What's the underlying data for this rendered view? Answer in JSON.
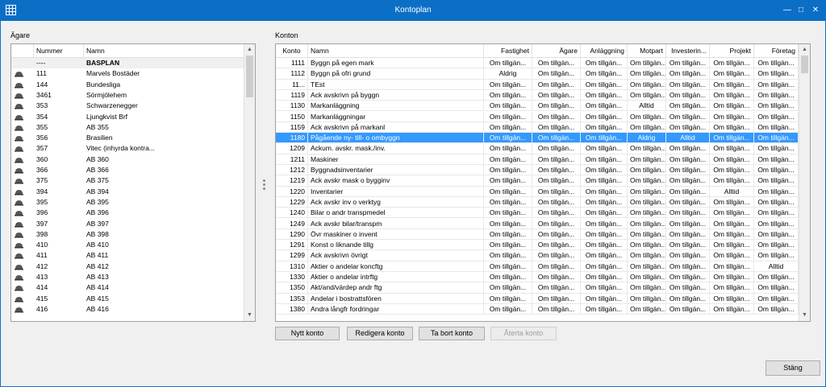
{
  "window": {
    "title": "Kontoplan",
    "minimize": "—",
    "maximize": "□",
    "close": "✕"
  },
  "owners": {
    "label": "Ägare",
    "columns": [
      "",
      "Nummer",
      "Namn"
    ],
    "rows": [
      {
        "icon": false,
        "number": "----",
        "name": "BASPLAN"
      },
      {
        "icon": true,
        "number": "111",
        "name": "Marvels Bostäder"
      },
      {
        "icon": true,
        "number": "144",
        "name": "Bundesliga"
      },
      {
        "icon": true,
        "number": "3461",
        "name": "Sörmjölehem"
      },
      {
        "icon": true,
        "number": "353",
        "name": "Schwarzenegger"
      },
      {
        "icon": true,
        "number": "354",
        "name": "Ljungkvist Brf"
      },
      {
        "icon": true,
        "number": "355",
        "name": "AB 355"
      },
      {
        "icon": true,
        "number": "356",
        "name": "Brasilien"
      },
      {
        "icon": true,
        "number": "357",
        "name": "Vitec (inhyrda kontra..."
      },
      {
        "icon": true,
        "number": "360",
        "name": "AB 360"
      },
      {
        "icon": true,
        "number": "366",
        "name": "AB 366"
      },
      {
        "icon": true,
        "number": "375",
        "name": "AB 375"
      },
      {
        "icon": true,
        "number": "394",
        "name": "AB 394"
      },
      {
        "icon": true,
        "number": "395",
        "name": "AB 395"
      },
      {
        "icon": true,
        "number": "396",
        "name": "AB 396"
      },
      {
        "icon": true,
        "number": "397",
        "name": "AB 397"
      },
      {
        "icon": true,
        "number": "398",
        "name": "AB 398"
      },
      {
        "icon": true,
        "number": "410",
        "name": "AB 410"
      },
      {
        "icon": true,
        "number": "411",
        "name": "AB 411"
      },
      {
        "icon": true,
        "number": "412",
        "name": "AB 412"
      },
      {
        "icon": true,
        "number": "413",
        "name": "AB 413"
      },
      {
        "icon": true,
        "number": "414",
        "name": "AB 414"
      },
      {
        "icon": true,
        "number": "415",
        "name": "AB 415"
      },
      {
        "icon": true,
        "number": "416",
        "name": "AB 416"
      }
    ]
  },
  "accounts": {
    "label": "Konton",
    "columns": [
      "Konto",
      "Namn",
      "Fastighet",
      "Ägare",
      "Anläggning",
      "Motpart",
      "Investerin...",
      "Projekt",
      "Företag"
    ],
    "selected_index": 8,
    "rows": [
      {
        "konto": "1111",
        "namn": "Byggn på egen mark",
        "vals": [
          "Om tillgän...",
          "Om tillgän...",
          "Om tillgän...",
          "Om tillgän...",
          "Om tillgän...",
          "Om tillgän...",
          "Om tillgän..."
        ]
      },
      {
        "konto": "1112",
        "namn": "Byggn på ofri grund",
        "vals": [
          "Aldrig",
          "Om tillgän...",
          "Om tillgän...",
          "Om tillgän...",
          "Om tillgän...",
          "Om tillgän...",
          "Om tillgän..."
        ]
      },
      {
        "konto": "11...",
        "namn": "TEst",
        "vals": [
          "Om tillgän...",
          "Om tillgän...",
          "Om tillgän...",
          "Om tillgän...",
          "Om tillgän...",
          "Om tillgän...",
          "Om tillgän..."
        ]
      },
      {
        "konto": "1119",
        "namn": "Ack avskrivn på byggn",
        "vals": [
          "Om tillgän...",
          "Om tillgän...",
          "Om tillgän...",
          "Om tillgän...",
          "Om tillgän...",
          "Om tillgän...",
          "Om tillgän..."
        ]
      },
      {
        "konto": "1130",
        "namn": "Markanläggning",
        "vals": [
          "Om tillgän...",
          "Om tillgän...",
          "Om tillgän...",
          "Alltid",
          "Om tillgän...",
          "Om tillgän...",
          "Om tillgän..."
        ]
      },
      {
        "konto": "1150",
        "namn": "Markanläggningar",
        "vals": [
          "Om tillgän...",
          "Om tillgän...",
          "Om tillgän...",
          "Om tillgän...",
          "Om tillgän...",
          "Om tillgän...",
          "Om tillgän..."
        ]
      },
      {
        "konto": "1159",
        "namn": "Ack avskrivn på markanl",
        "vals": [
          "Om tillgän...",
          "Om tillgän...",
          "Om tillgän...",
          "Om tillgän...",
          "Om tillgän...",
          "Om tillgän...",
          "Om tillgän..."
        ]
      },
      {
        "konto": "1180",
        "namn": "Pågående ny- till- o ombyggn",
        "vals": [
          "Om tillgän...",
          "Om tillgän...",
          "Om tillgän...",
          "Aldrig",
          "Alltid",
          "Om tillgän...",
          "Om tillgän..."
        ]
      },
      {
        "konto": "1209",
        "namn": "Ackum. avskr. mask./inv.",
        "vals": [
          "Om tillgän...",
          "Om tillgän...",
          "Om tillgän...",
          "Om tillgän...",
          "Om tillgän...",
          "Om tillgän...",
          "Om tillgän..."
        ]
      },
      {
        "konto": "1211",
        "namn": "Maskiner",
        "vals": [
          "Om tillgän...",
          "Om tillgän...",
          "Om tillgän...",
          "Om tillgän...",
          "Om tillgän...",
          "Om tillgän...",
          "Om tillgän..."
        ]
      },
      {
        "konto": "1212",
        "namn": "Byggnadsinventarier",
        "vals": [
          "Om tillgän...",
          "Om tillgän...",
          "Om tillgän...",
          "Om tillgän...",
          "Om tillgän...",
          "Om tillgän...",
          "Om tillgän..."
        ]
      },
      {
        "konto": "1219",
        "namn": "Ack avskr mask o bygginv",
        "vals": [
          "Om tillgän...",
          "Om tillgän...",
          "Om tillgän...",
          "Om tillgän...",
          "Om tillgän...",
          "Om tillgän...",
          "Om tillgän..."
        ]
      },
      {
        "konto": "1220",
        "namn": "Inventarier",
        "vals": [
          "Om tillgän...",
          "Om tillgän...",
          "Om tillgän...",
          "Om tillgän...",
          "Om tillgän...",
          "Alltid",
          "Om tillgän..."
        ]
      },
      {
        "konto": "1229",
        "namn": "Ack avskr inv o verktyg",
        "vals": [
          "Om tillgän...",
          "Om tillgän...",
          "Om tillgän...",
          "Om tillgän...",
          "Om tillgän...",
          "Om tillgän...",
          "Om tillgän..."
        ]
      },
      {
        "konto": "1240",
        "namn": "Bilar o andr transpmedel",
        "vals": [
          "Om tillgän...",
          "Om tillgän...",
          "Om tillgän...",
          "Om tillgän...",
          "Om tillgän...",
          "Om tillgän...",
          "Om tillgän..."
        ]
      },
      {
        "konto": "1249",
        "namn": "Ack avskr bilar/transpm",
        "vals": [
          "Om tillgän...",
          "Om tillgän...",
          "Om tillgän...",
          "Om tillgän...",
          "Om tillgän...",
          "Om tillgän...",
          "Om tillgän..."
        ]
      },
      {
        "konto": "1290",
        "namn": "Övr maskiner o invent",
        "vals": [
          "Om tillgän...",
          "Om tillgän...",
          "Om tillgän...",
          "Om tillgän...",
          "Om tillgän...",
          "Om tillgän...",
          "Om tillgän..."
        ]
      },
      {
        "konto": "1291",
        "namn": "Konst o liknande tillg",
        "vals": [
          "Om tillgän...",
          "Om tillgän...",
          "Om tillgän...",
          "Om tillgän...",
          "Om tillgän...",
          "Om tillgän...",
          "Om tillgän..."
        ]
      },
      {
        "konto": "1299",
        "namn": "Ack avskrivn övrigt",
        "vals": [
          "Om tillgän...",
          "Om tillgän...",
          "Om tillgän...",
          "Om tillgän...",
          "Om tillgän...",
          "Om tillgän...",
          "Om tillgän..."
        ]
      },
      {
        "konto": "1310",
        "namn": "Aktier o andelar koncftg",
        "vals": [
          "Om tillgän...",
          "Om tillgän...",
          "Om tillgän...",
          "Om tillgän...",
          "Om tillgän...",
          "Om tillgän...",
          "Alltid"
        ]
      },
      {
        "konto": "1330",
        "namn": "Aktier o andelar intrftg",
        "vals": [
          "Om tillgän...",
          "Om tillgän...",
          "Om tillgän...",
          "Om tillgän...",
          "Om tillgän...",
          "Om tillgän...",
          "Om tillgän..."
        ]
      },
      {
        "konto": "1350",
        "namn": "Akt/and/värdep andr ftg",
        "vals": [
          "Om tillgän...",
          "Om tillgän...",
          "Om tillgän...",
          "Om tillgän...",
          "Om tillgän...",
          "Om tillgän...",
          "Om tillgän..."
        ]
      },
      {
        "konto": "1353",
        "namn": "Andelar i bostrattsfören",
        "vals": [
          "Om tillgän...",
          "Om tillgän...",
          "Om tillgän...",
          "Om tillgän...",
          "Om tillgän...",
          "Om tillgän...",
          "Om tillgän..."
        ]
      },
      {
        "konto": "1380",
        "namn": "Andra långfr fordringar",
        "vals": [
          "Om tillgän...",
          "Om tillgän...",
          "Om tillgän...",
          "Om tillgän...",
          "Om tillgän...",
          "Om tillgän...",
          "Om tillgän..."
        ]
      }
    ]
  },
  "buttons": {
    "new": "Nytt konto",
    "edit": "Redigera konto",
    "delete": "Ta bort konto",
    "restore": "Återta konto",
    "close": "Stäng"
  },
  "colors": {
    "titlebar": "#0b6fc6",
    "selection": "#3399ff"
  }
}
